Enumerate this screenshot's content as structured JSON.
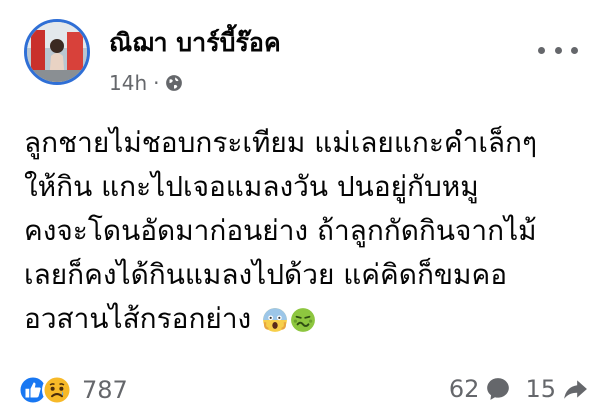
{
  "post": {
    "author": "ณิฌา บาร์บี้ร๊อค",
    "time": "14h",
    "privacy_icon": "globe-icon",
    "more_icon": "more-options-icon",
    "text_lines": [
      "ลูกชายไม่ชอบกระเทียม แม่เลยแกะคำเล็กๆ",
      "ให้กิน แกะไปเจอแมลงวัน ปนอยู่กับหมู",
      "คงจะโดนอัดมาก่อนย่าง ถ้าลูกกัดกินจากไม้",
      "เลยก็คงได้กินแมลงไปด้วย แค่คิดก็ขมคอ",
      "อวสานไส้กรอกย่าง"
    ],
    "text_emojis": [
      "scream-emoji",
      "nauseated-emoji"
    ],
    "reactions": {
      "icons": [
        "like-reaction-icon",
        "sad-reaction-icon"
      ],
      "count": "787"
    },
    "comments": {
      "count": "62",
      "icon": "comment-icon"
    },
    "shares": {
      "count": "15",
      "icon": "share-icon"
    },
    "colors": {
      "like": "#1877f2",
      "sad": "#f7b928",
      "secondary_text": "#65676b"
    }
  }
}
